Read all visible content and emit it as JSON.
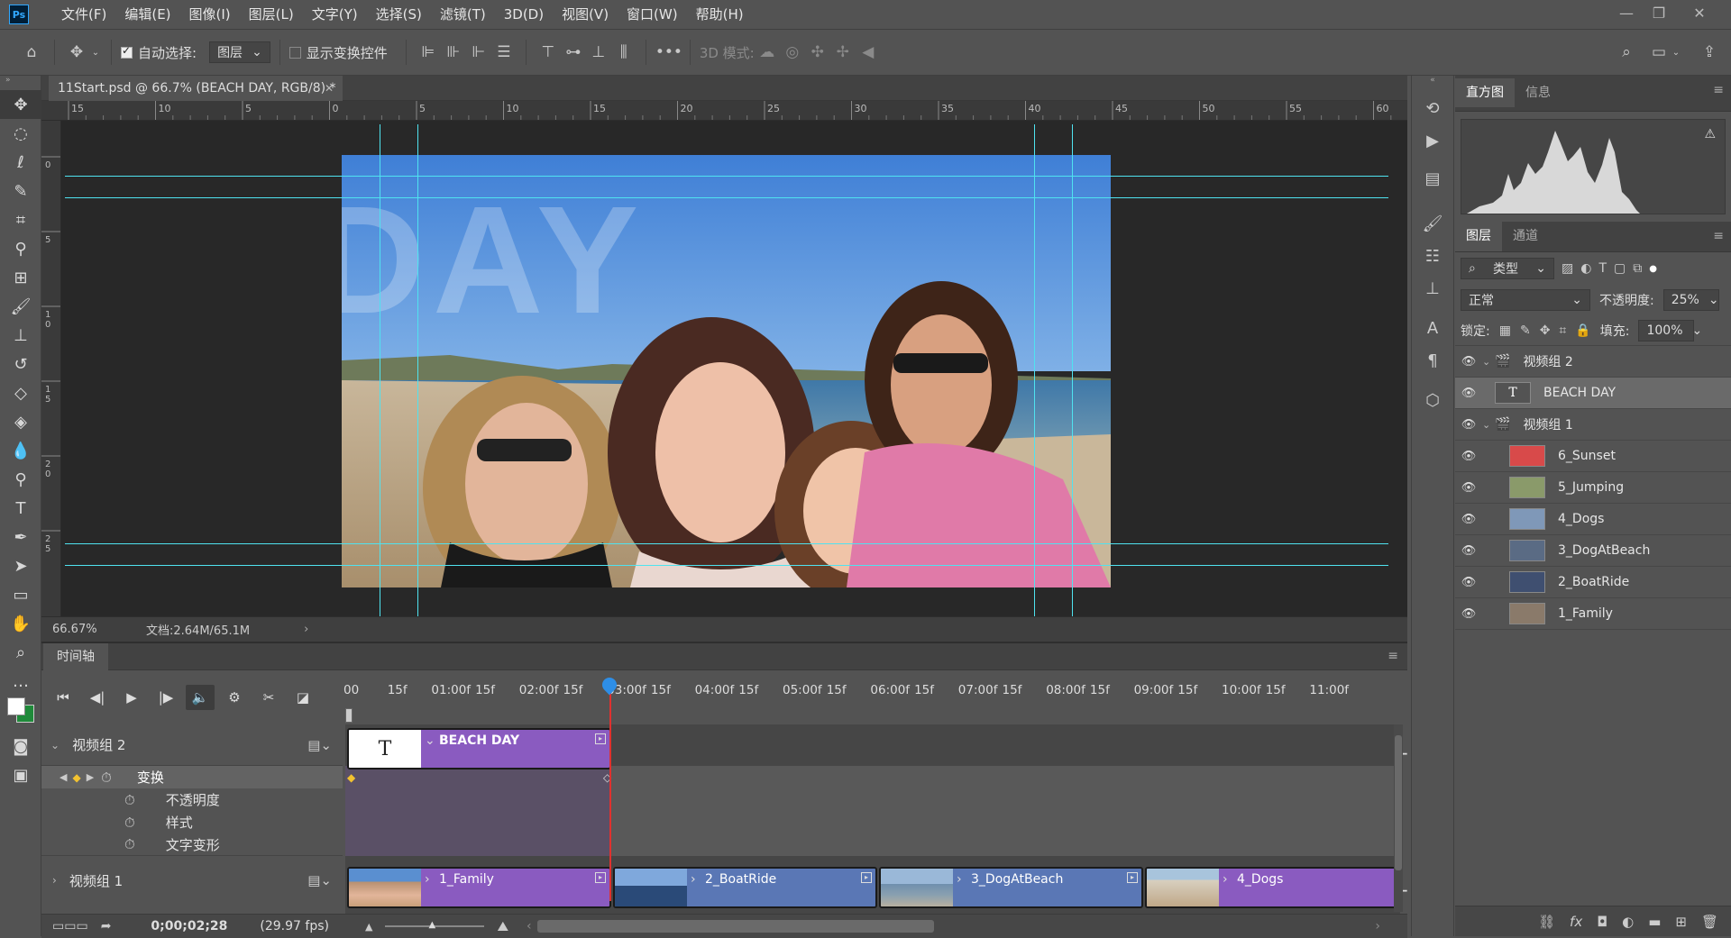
{
  "app": {
    "logo": "Ps"
  },
  "menu": [
    "文件(F)",
    "编辑(E)",
    "图像(I)",
    "图层(L)",
    "文字(Y)",
    "选择(S)",
    "滤镜(T)",
    "3D(D)",
    "视图(V)",
    "窗口(W)",
    "帮助(H)"
  ],
  "window_controls": {
    "minimize": "—",
    "restore": "❐",
    "close": "✕"
  },
  "options": {
    "auto_select_label": "自动选择:",
    "auto_select_value": "图层",
    "show_transform_label": "显示变换控件",
    "mode_3d_label": "3D 模式:"
  },
  "document": {
    "tab_title": "11Start.psd @ 66.7% (BEACH DAY, RGB/8) *",
    "close": "✕",
    "canvas_text": "DAY",
    "zoom": "66.67%",
    "doc_info": "文档:2.64M/65.1M"
  },
  "ruler_top": [
    "15",
    "10",
    "5",
    "0",
    "5",
    "10",
    "15",
    "20",
    "25",
    "30",
    "35",
    "40",
    "45",
    "50",
    "55",
    "60"
  ],
  "ruler_left": [
    "0",
    "5",
    "1\n0",
    "1\n5",
    "2\n0",
    "2\n5"
  ],
  "timeline": {
    "tab": "时间轴",
    "ticks": [
      "00",
      "15f",
      "01:00f",
      "15f",
      "02:00f",
      "15f",
      "03:00f",
      "15f",
      "04:00f",
      "15f",
      "05:00f",
      "15f",
      "06:00f",
      "15f",
      "07:00f",
      "15f",
      "08:00f",
      "15f",
      "09:00f",
      "15f",
      "10:00f",
      "15f",
      "11:00f"
    ],
    "group2_label": "视频组 2",
    "group1_label": "视频组 1",
    "props": [
      "变换",
      "不透明度",
      "样式",
      "文字变形"
    ],
    "text_clip": "BEACH DAY",
    "clips": [
      "1_Family",
      "2_BoatRide",
      "3_DogAtBeach",
      "4_Dogs"
    ],
    "timecode": "0;00;02;28",
    "fps": "(29.97 fps)"
  },
  "panels": {
    "histogram_tab": "直方图",
    "info_tab": "信息",
    "layers_tab": "图层",
    "channels_tab": "通道",
    "filter_kind": "类型",
    "blend_mode": "正常",
    "opacity_label": "不透明度:",
    "opacity_value": "25%",
    "lock_label": "锁定:",
    "fill_label": "填充:",
    "fill_value": "100%"
  },
  "layers": [
    {
      "name": "视频组 2",
      "type": "group"
    },
    {
      "name": "BEACH DAY",
      "type": "text"
    },
    {
      "name": "视频组 1",
      "type": "group"
    },
    {
      "name": "6_Sunset",
      "type": "image",
      "color": "#d84a4a"
    },
    {
      "name": "5_Jumping",
      "type": "image",
      "color": "#8a9a6a"
    },
    {
      "name": "4_Dogs",
      "type": "image",
      "color": "#7f98b8"
    },
    {
      "name": "3_DogAtBeach",
      "type": "image",
      "color": "#5a6b84"
    },
    {
      "name": "2_BoatRide",
      "type": "image",
      "color": "#3f4f70"
    },
    {
      "name": "1_Family",
      "type": "image",
      "color": "#8a7a6a"
    }
  ],
  "colors": {
    "guide": "#4fe3f0",
    "clip_purple": "#8a5bc0",
    "clip_blue": "#5a77b5",
    "playhead": "#e0312f",
    "accent_blue": "#2e8ee6"
  }
}
